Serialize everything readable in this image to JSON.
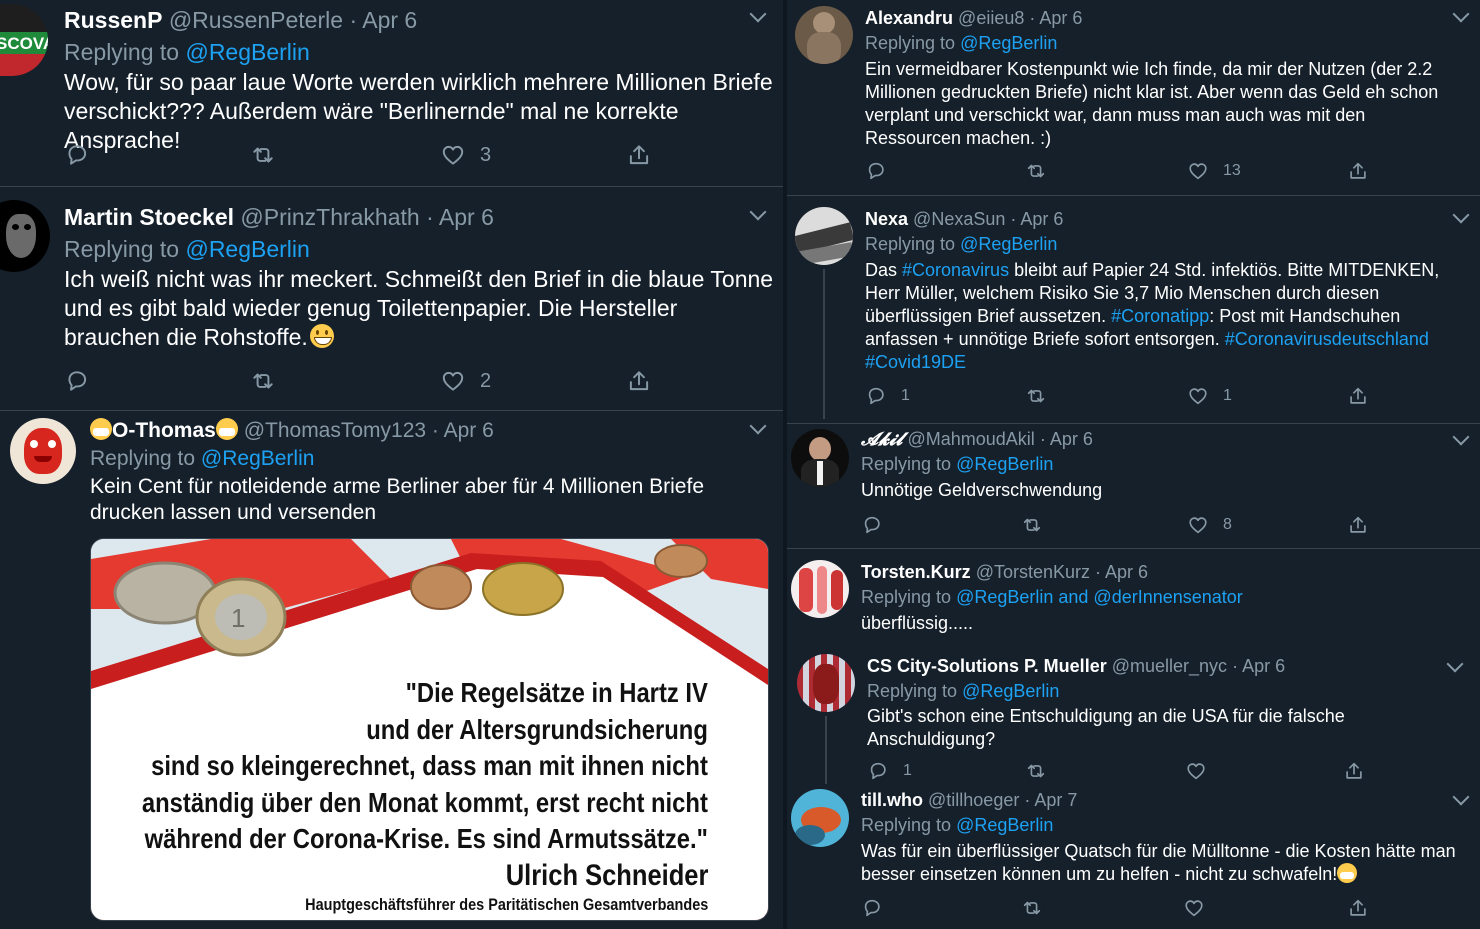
{
  "left": {
    "t1": {
      "name": "RussenP",
      "handle": "@RussenPeterle",
      "date": "Apr 6",
      "replying_prefix": "Replying to",
      "replying_to": "@RegBerlin",
      "avatar_text": "SCOVA",
      "text": "Wow, für so paar laue Worte werden wirklich mehrere Millionen Briefe verschickt??? Außerdem wäre \"Berlinernde\" mal ne korrekte Ansprache!",
      "likes": "3"
    },
    "t2": {
      "name": "Martin Stoeckel",
      "handle": "@PrinzThrakhath",
      "date": "Apr 6",
      "replying_prefix": "Replying to",
      "replying_to": "@RegBerlin",
      "text": "Ich weiß nicht was ihr meckert. Schmeißt den Brief in die blaue Tonne und es gibt bald wieder genug Toilettenpapier. Die Hersteller brauchen die Rohstoffe.",
      "likes": "2"
    },
    "t3": {
      "name": "O-Thomas",
      "handle": "@ThomasTomy123",
      "date": "Apr 6",
      "replying_prefix": "Replying to",
      "replying_to": "@RegBerlin",
      "text": "Kein Cent für notleidende arme Berliner  aber für 4 Millionen Briefe drucken  lassen und versenden",
      "image": {
        "quote": "\"Die Regelsätze in Hartz IV\nund der Altersgrundsicherung\nsind so kleingerechnet, dass man mit ihnen nicht\nanständig über den Monat kommt, erst recht nicht\nwährend der Corona-Krise. Es sind Armutssätze.\"",
        "author": "Ulrich Schneider",
        "author_title": "Hauptgeschäftsführer des Paritätischen Gesamtverbandes"
      }
    }
  },
  "right": {
    "r1": {
      "name": "Alexandru",
      "handle": "@eiieu8",
      "date": "Apr 6",
      "replying_prefix": "Replying to",
      "replying_to": "@RegBerlin",
      "text": "Ein vermeidbarer Kostenpunkt wie Ich finde, da mir der Nutzen (der 2.2 Millionen gedruckten Briefe) nicht klar ist. Aber wenn das Geld eh schon verplant und verschickt war, dann muss man auch was mit den Ressourcen machen. :)",
      "likes": "13"
    },
    "r2": {
      "name": "Nexa",
      "handle": "@NexaSun",
      "date": "Apr 6",
      "replying_prefix": "Replying to",
      "replying_to": "@RegBerlin",
      "text_parts": [
        {
          "t": "Das ",
          "link": false
        },
        {
          "t": "#Coronavirus",
          "link": true
        },
        {
          "t": " bleibt auf Papier 24 Std. infektiös. Bitte MITDENKEN, Herr Müller, welchem Risiko Sie 3,7 Mio Menschen durch diesen überflüssigen Brief aussetzen. ",
          "link": false
        },
        {
          "t": "#Coronatipp",
          "link": true
        },
        {
          "t": ": Post mit Handschuhen anfassen + unnötige Briefe sofort entsorgen. ",
          "link": false
        },
        {
          "t": "#Coronavirusdeutschland",
          "link": true
        },
        {
          "t": " ",
          "link": false
        },
        {
          "t": "#Covid19DE",
          "link": true
        }
      ],
      "replies": "1",
      "likes": "1"
    },
    "r3": {
      "name": "𝓐𝓴𝓲𝓵",
      "handle": "@MahmoudAkil",
      "date": "Apr 6",
      "replying_prefix": "Replying to",
      "replying_to": "@RegBerlin",
      "text": "Unnötige Geldverschwendung",
      "likes": "8"
    },
    "r4": {
      "name": "Torsten.Kurz",
      "handle": "@TorstenKurz",
      "date": "Apr 6",
      "replying_prefix": "Replying to",
      "replying_to": "@RegBerlin and @derInnensenator",
      "text": "überflüssig....."
    },
    "r5": {
      "name": "CS City-Solutions P. Mueller",
      "handle": "@mueller_nyc",
      "date": "Apr 6",
      "replying_prefix": "Replying to",
      "replying_to": "@RegBerlin",
      "text": "Gibt's schon eine Entschuldigung an die USA für die falsche Anschuldigung?",
      "replies": "1"
    },
    "r6": {
      "name": "till.who",
      "handle": "@tillhoeger",
      "date": "Apr 7",
      "replying_prefix": "Replying to",
      "replying_to": "@RegBerlin",
      "text": "Was für ein überflüssiger Quatsch für die Mülltonne - die Kosten hätte man besser einsetzen können um zu helfen - nicht zu schwafeln!"
    }
  },
  "colors": {
    "background": "#15202b",
    "divider": "#38444d",
    "muted": "#8899a6",
    "link": "#1da1f2"
  },
  "icons": [
    "reply-icon",
    "retweet-icon",
    "like-icon",
    "share-icon",
    "chevron-down-icon"
  ]
}
